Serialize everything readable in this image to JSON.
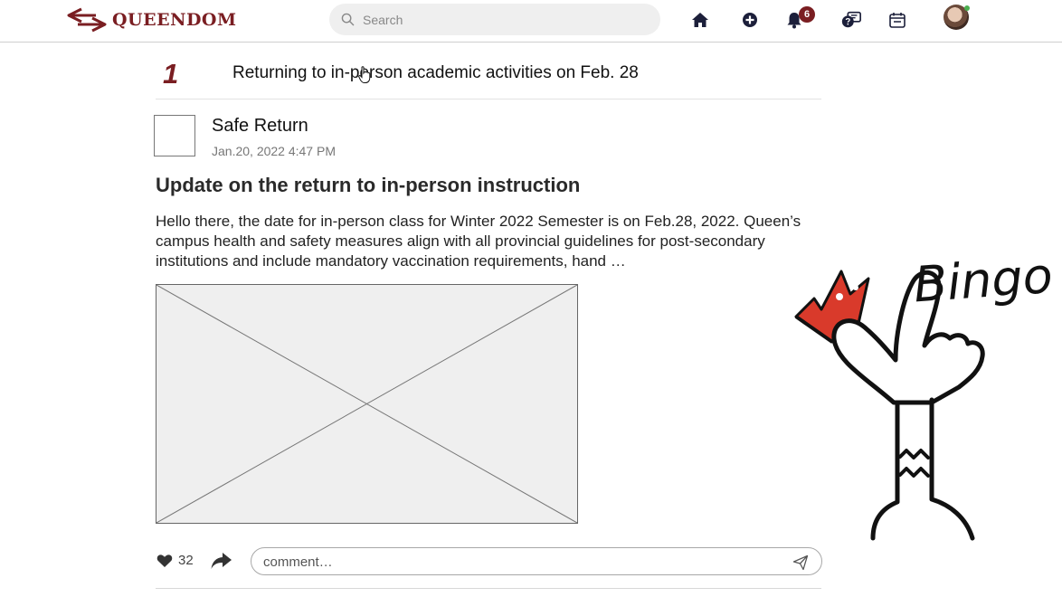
{
  "header": {
    "logo_text": "QUEENDOM",
    "search_placeholder": "Search",
    "notification_count": "6",
    "nav_icons": [
      "home-icon",
      "add-circle-icon",
      "bell-icon",
      "chat-icon",
      "calendar-icon"
    ],
    "accent_color": "#7a1e22"
  },
  "headline": {
    "rank": "1",
    "text": "Returning to in-person academic activities on Feb. 28"
  },
  "post": {
    "author": "Safe Return",
    "date": "Jan.20, 2022 4:47 PM",
    "title": "Update on the return to in-person instruction",
    "body": "Hello there, the date for in-person class for Winter 2022 Semester is on Feb.28, 2022. Queen’s campus health and safety measures align with all provincial guidelines for post-secondary institutions and include mandatory vaccination requirements, hand  …",
    "likes": "32",
    "comment_placeholder": "comment…"
  },
  "sticker": {
    "text": "Bingo"
  }
}
